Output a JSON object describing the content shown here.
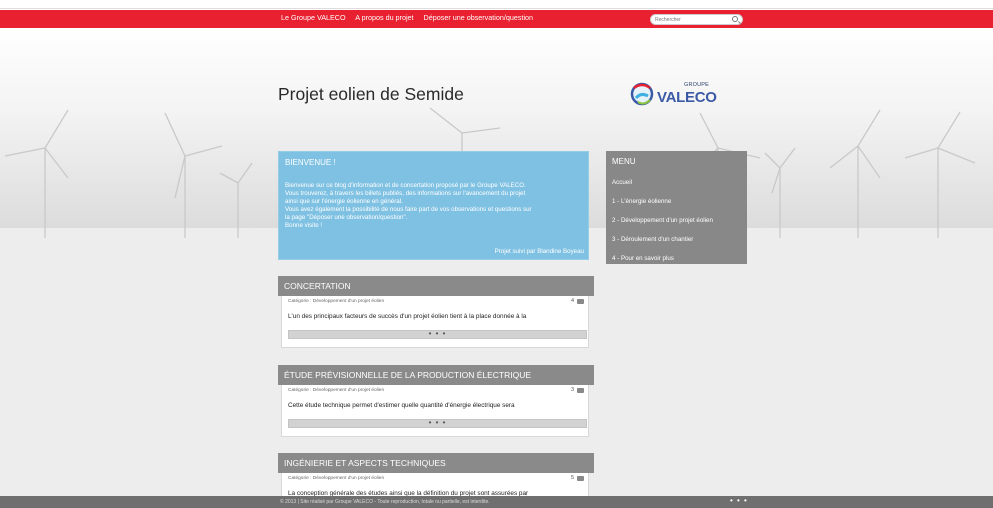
{
  "nav": {
    "links": [
      "Le Groupe VALECO",
      "A propos du projet",
      "Déposer une observation/question"
    ],
    "search_placeholder": "Rechercher"
  },
  "header": {
    "site_title": "Projet eolien de Semide",
    "logo_groupe": "GROUPE",
    "logo_valeco": "VALECO"
  },
  "welcome": {
    "title": "BIENVENUE !",
    "lines": [
      "Bienvenue sur ce blog d'information et de concertation proposé par le Groupe VALECO.",
      "Vous trouverez, à travers les billets publiés, des informations sur l'avancement du projet",
      "ainsi que sur l'énergie éolienne en général.",
      "Vous avez également la possibilité de nous faire part de vos observations et questions sur",
      "la page \"Déposer une observation/question\".",
      "Bonne visite !"
    ],
    "footer": "Projet suivi par Blandine Boyeau"
  },
  "menu": {
    "title": "MENU",
    "items": [
      "Accueil",
      "1 - L'énergie éolienne",
      "2 - Développement d'un projet éolien",
      "3 - Déroulement d'un chantier",
      "4 - Pour en savoir plus"
    ]
  },
  "articles": [
    {
      "title": "CONCERTATION",
      "category": "Catégorie : Développement d'un projet éolien",
      "comments": "4",
      "excerpt": "L'un des principaux facteurs de succès d'un projet éolien tient à la place donnée à la",
      "more": "• • •"
    },
    {
      "title": "ÉTUDE PRÉVISIONNELLE DE LA PRODUCTION ÉLECTRIQUE",
      "category": "Catégorie : Développement d'un projet éolien",
      "comments": "3",
      "excerpt": "Cette étude technique permet d'estimer quelle quantité d'énergie électrique sera",
      "more": "• • •"
    },
    {
      "title": "INGÉNIERIE ET ASPECTS TECHNIQUES",
      "category": "Catégorie : Développement d'un projet éolien",
      "comments": "5",
      "excerpt": "La conception générale des études ainsi que la définition du projet sont assurées par",
      "more": "• • •"
    }
  ],
  "footer": {
    "text": "© 2013 | Site réalisé par Groupe VALECO - Toute reproduction, totale ou partielle, est interdite.",
    "dots": "• • •"
  },
  "colors": {
    "nav_red": "#e8202f",
    "welcome_blue": "#7fc1e2",
    "menu_grey": "#888888",
    "logo_blue": "#3b5aa6"
  }
}
